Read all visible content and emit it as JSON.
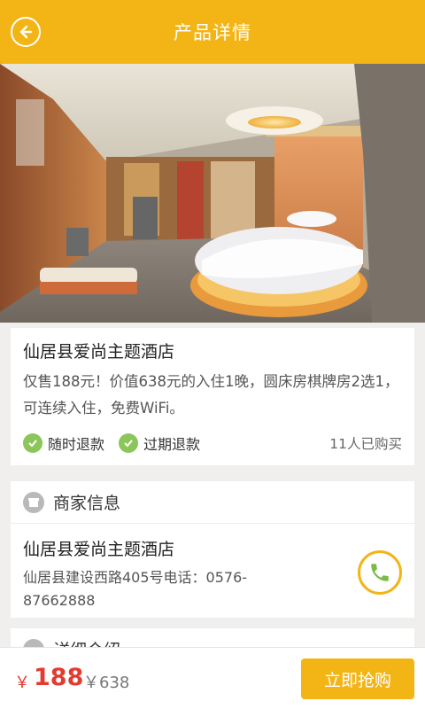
{
  "header": {
    "title": "产品详情",
    "back_icon": "back-arrow-icon"
  },
  "hero": {
    "alt": "hotel room photo"
  },
  "product": {
    "name": "仙居县爱尚主题酒店",
    "description": "仅售188元！价值638元的入住1晚，圆床房棋牌房2选1，可连续入住，免费WiFi。",
    "tags": [
      "随时退款",
      "过期退款"
    ],
    "sold": "11人已购买"
  },
  "merchant": {
    "section_title": "商家信息",
    "name": "仙居县爱尚主题酒店",
    "address": "仙居县建设西路405号电话：0576-87662888"
  },
  "detail": {
    "section_title": "详细介绍"
  },
  "footer": {
    "currency": "￥",
    "price": "188",
    "original_price": "￥638",
    "buy_label": "立即抢购"
  },
  "colors": {
    "accent": "#f3b416",
    "price": "#e23b2f",
    "tag_check": "#8cc55a"
  }
}
